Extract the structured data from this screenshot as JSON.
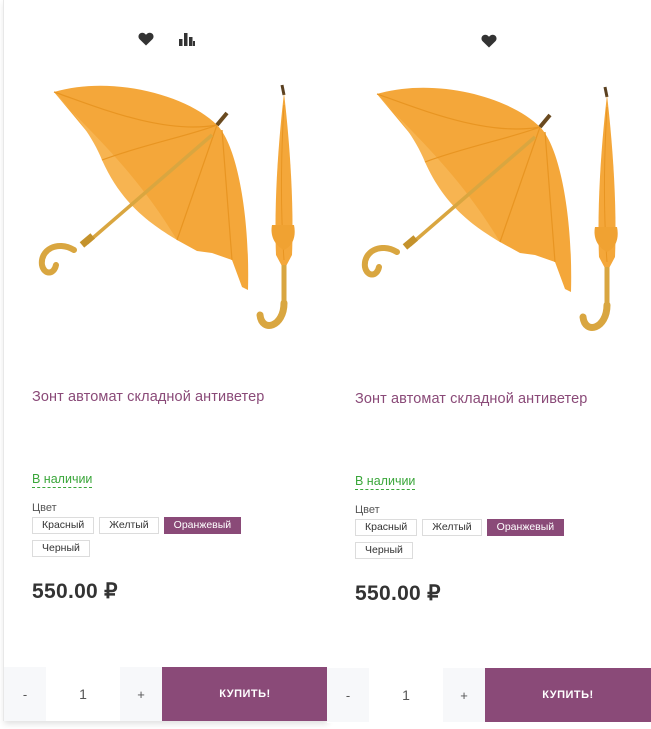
{
  "products": [
    {
      "title": "Зонт автомат складной антиветер",
      "stock": "В наличии",
      "prop_label": "Цвет",
      "colors": [
        {
          "label": "Красный",
          "active": false
        },
        {
          "label": "Желтый",
          "active": false
        },
        {
          "label": "Оранжевый",
          "active": true
        },
        {
          "label": "Черный",
          "active": false
        }
      ],
      "price": "550.00 ₽",
      "qty": {
        "minus": "-",
        "value": "1",
        "plus": "+"
      },
      "buy_label": "КУПИТЬ!",
      "icons": [
        "heart-icon",
        "bar-chart-icon"
      ]
    },
    {
      "title": "Зонт автомат складной антиветер",
      "stock": "В наличии",
      "prop_label": "Цвет",
      "colors": [
        {
          "label": "Красный",
          "active": false
        },
        {
          "label": "Желтый",
          "active": false
        },
        {
          "label": "Оранжевый",
          "active": true
        },
        {
          "label": "Черный",
          "active": false
        }
      ],
      "price": "550.00 ₽",
      "qty": {
        "minus": "-",
        "value": "1",
        "plus": "+"
      },
      "buy_label": "КУПИТЬ!",
      "icons": [
        "heart-icon"
      ]
    }
  ],
  "colors": {
    "accent": "#8a4a78",
    "in_stock": "#3aa63a",
    "umbrella": "#f4a73a",
    "handle": "#d9a640",
    "icon": "#333333"
  }
}
